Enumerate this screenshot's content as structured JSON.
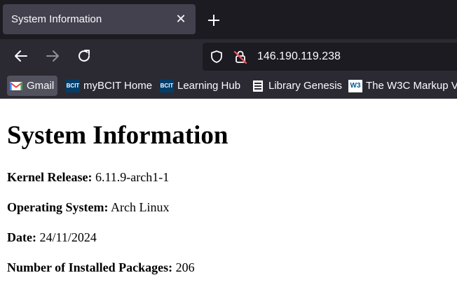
{
  "browser": {
    "tab": {
      "title": "System Information",
      "close": "✕"
    },
    "address": "146.190.119.238",
    "bookmarks": [
      {
        "label": "Gmail",
        "icon": "gmail-icon"
      },
      {
        "label": "myBCIT Home",
        "icon": "bcit-icon",
        "icon_text": "BCIT"
      },
      {
        "label": "Learning Hub",
        "icon": "bcit-icon",
        "icon_text": "BCIT"
      },
      {
        "label": "Library Genesis",
        "icon": "library-genesis-icon"
      },
      {
        "label": "The W3C Markup Va",
        "icon": "w3c-icon",
        "icon_text": "W3"
      }
    ]
  },
  "page": {
    "title": "System Information",
    "fields": [
      {
        "label": "Kernel Release:",
        "value": "6.11.9-arch1-1"
      },
      {
        "label": "Operating System:",
        "value": "Arch Linux"
      },
      {
        "label": "Date:",
        "value": "24/11/2024"
      },
      {
        "label": "Number of Installed Packages:",
        "value": "206"
      }
    ]
  }
}
